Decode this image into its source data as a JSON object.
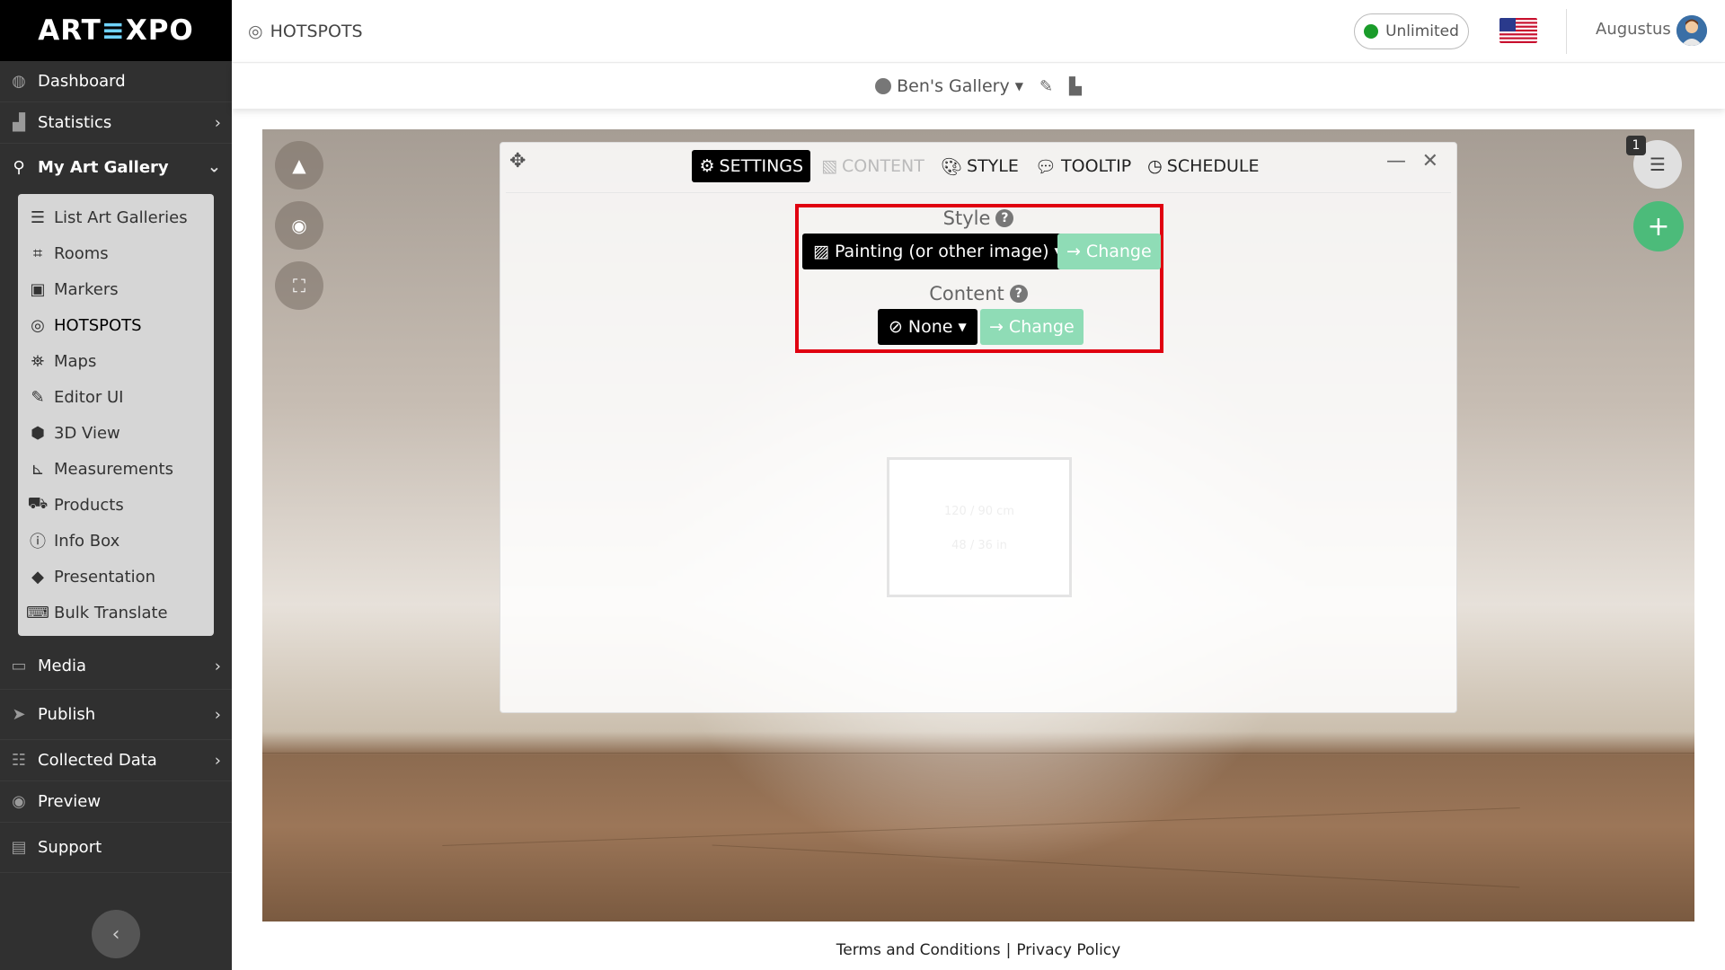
{
  "app": {
    "logo": "ARTEXPO"
  },
  "sidebar": {
    "items": [
      {
        "label": "Dashboard",
        "icon": "dashboard-icon"
      },
      {
        "label": "Statistics",
        "icon": "chart-icon"
      },
      {
        "label": "My Art Gallery",
        "icon": "gallery-icon"
      }
    ],
    "submenu": [
      {
        "label": "List Art Galleries",
        "icon": "list-icon"
      },
      {
        "label": "Rooms",
        "icon": "rooms-icon"
      },
      {
        "label": "Markers",
        "icon": "markers-icon"
      },
      {
        "label": "HOTSPOTS",
        "icon": "hotspots-icon"
      },
      {
        "label": "Maps",
        "icon": "maps-icon"
      },
      {
        "label": "Editor UI",
        "icon": "editor-icon"
      },
      {
        "label": "3D View",
        "icon": "cube-icon"
      },
      {
        "label": "Measurements",
        "icon": "ruler-icon"
      },
      {
        "label": "Products",
        "icon": "cart-icon"
      },
      {
        "label": "Info Box",
        "icon": "info-icon"
      },
      {
        "label": "Presentation",
        "icon": "presentation-icon"
      },
      {
        "label": "Bulk Translate",
        "icon": "translate-icon"
      }
    ],
    "bottom_items": [
      {
        "label": "Media",
        "icon": "media-icon"
      },
      {
        "label": "Publish",
        "icon": "publish-icon"
      },
      {
        "label": "Collected Data",
        "icon": "data-icon"
      },
      {
        "label": "Preview",
        "icon": "eye-icon"
      },
      {
        "label": "Support",
        "icon": "support-icon"
      }
    ]
  },
  "header": {
    "page_title": "HOTSPOTS",
    "plan": "Unlimited",
    "plan_status_color": "#1a9c2a",
    "username": "Augustus"
  },
  "subheader": {
    "gallery_name": "Ben's Gallery"
  },
  "dialog": {
    "tabs": [
      {
        "label": "SETTINGS",
        "state": "active"
      },
      {
        "label": "CONTENT",
        "state": "disabled"
      },
      {
        "label": "STYLE",
        "state": "normal"
      },
      {
        "label": "TOOLTIP",
        "state": "normal"
      },
      {
        "label": "SCHEDULE",
        "state": "normal"
      }
    ],
    "style_label": "Style",
    "style_value": "Painting (or other image)",
    "content_label": "Content",
    "content_value": "None",
    "change_label": "Change",
    "help_glyph": "?",
    "preview_dim_cm": "120 / 90 cm",
    "preview_dim_in": "48 / 36 in"
  },
  "viewer": {
    "hotspot_count": "1"
  },
  "footer": {
    "terms": "Terms and Conditions",
    "separator": "|",
    "privacy": "Privacy Policy"
  },
  "colors": {
    "accent_green": "#4cbb7a",
    "change_green": "#8fdcb6",
    "highlight_red": "#e00010"
  }
}
